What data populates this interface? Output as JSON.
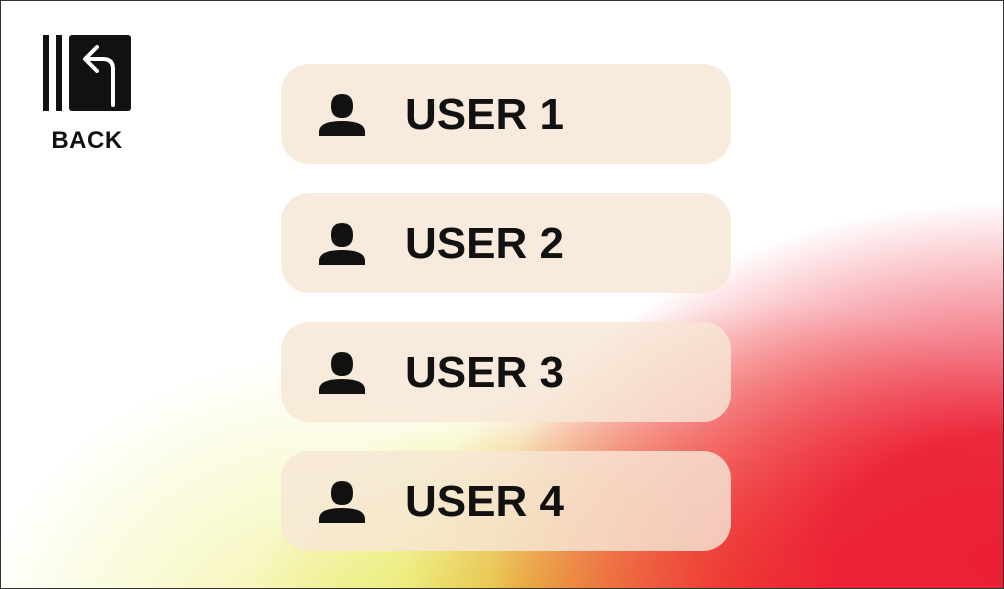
{
  "back": {
    "label": "BACK",
    "icon": "back-arrow-icon"
  },
  "users": [
    {
      "label": "USER 1",
      "icon": "user-icon"
    },
    {
      "label": "USER 2",
      "icon": "user-icon"
    },
    {
      "label": "USER 3",
      "icon": "user-icon"
    },
    {
      "label": "USER 4",
      "icon": "user-icon"
    }
  ],
  "colors": {
    "button_bg": "#f6e6d6",
    "text": "#111111",
    "gradient_red": "#ec1e34",
    "gradient_orange": "#f05a1e",
    "gradient_yellow": "#e2e43c"
  }
}
